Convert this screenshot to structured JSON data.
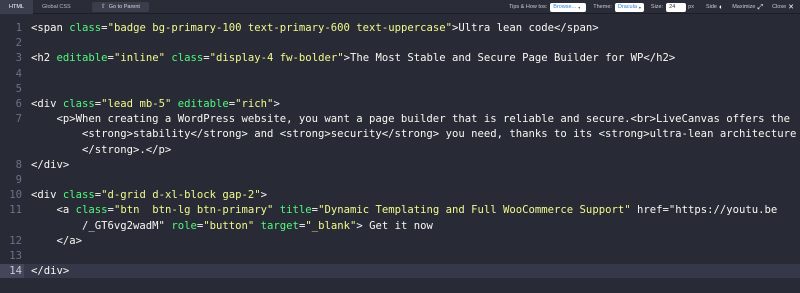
{
  "toolbar": {
    "tabs": [
      {
        "label": "HTML",
        "active": true
      },
      {
        "label": "Global CSS",
        "active": false
      }
    ],
    "parent_button": "Go to Parent",
    "tips_label": "Tips & How tos:",
    "tips_value": "Browse...",
    "theme_label": "Theme:",
    "theme_value": "Dracula",
    "size_label": "Size:",
    "size_value": "24",
    "size_unit": "px",
    "side_label": "Side",
    "maximize_label": "Maximize",
    "close_label": "Close"
  },
  "editor": {
    "theme_colors": {
      "background": "#282a36",
      "text": "#f8f8f2",
      "attribute": "#50fa7b",
      "string": "#f1fa8c",
      "line_number": "#6d7088"
    },
    "current_line": 14,
    "lines": [
      {
        "n": "1",
        "text": "<span class=\"badge bg-primary-100 text-primary-600 text-uppercase\">Ultra lean code</span>"
      },
      {
        "n": "2",
        "text": ""
      },
      {
        "n": "3",
        "text": "<h2 editable=\"inline\" class=\"display-4 fw-bolder\">The Most Stable and Secure Page Builder for WP</h2>"
      },
      {
        "n": "4",
        "text": ""
      },
      {
        "n": "5",
        "text": ""
      },
      {
        "n": "6",
        "text": "<div class=\"lead mb-5\" editable=\"rich\">"
      },
      {
        "n": "7",
        "text": "    <p>When creating a WordPress website, you want a page builder that is reliable and secure.<br>LiveCanvas offers the"
      },
      {
        "n": "",
        "text": "        <strong>stability</strong> and <strong>security</strong> you need, thanks to its <strong>ultra-lean architecture"
      },
      {
        "n": "",
        "text": "        </strong>.</p>"
      },
      {
        "n": "8",
        "text": "</div>"
      },
      {
        "n": "9",
        "text": ""
      },
      {
        "n": "10",
        "text": "<div class=\"d-grid d-xl-block gap-2\">"
      },
      {
        "n": "11",
        "text": "    <a class=\"btn  btn-lg btn-primary\" title=\"Dynamic Templating and Full WooCommerce Support\" href=\"https://youtu.be"
      },
      {
        "n": "",
        "text": "        /_GT6vg2wadM\" role=\"button\" target=\"_blank\"> Get it now"
      },
      {
        "n": "12",
        "text": "    </a>"
      },
      {
        "n": "13",
        "text": ""
      },
      {
        "n": "14",
        "text": "</div>"
      }
    ]
  }
}
